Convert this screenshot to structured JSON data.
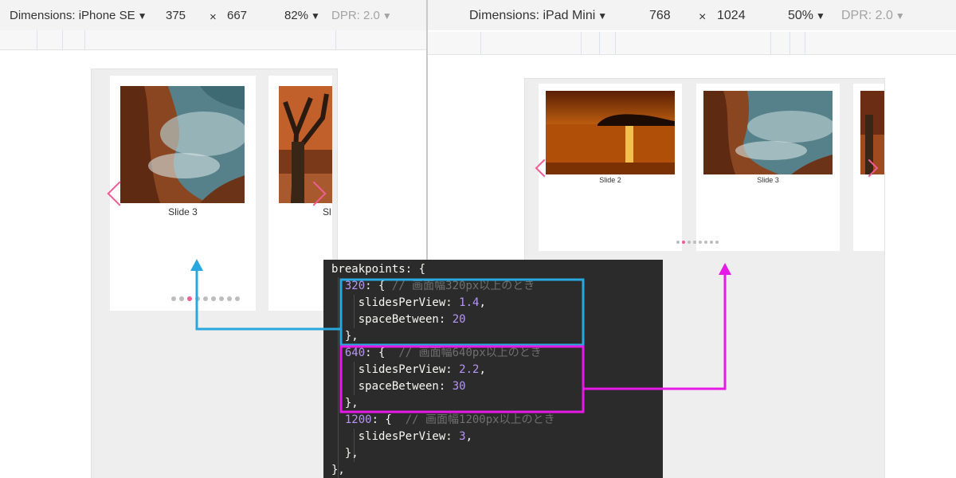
{
  "left": {
    "dimensions_label": "Dimensions: iPhone SE",
    "width": "375",
    "times": "×",
    "height": "667",
    "zoom": "82%",
    "dpr": "DPR: 2.0",
    "slides": [
      {
        "caption": "Slide 3",
        "image": "rocky-coast-photo"
      },
      {
        "caption": "Sl",
        "image": "autumn-tree-photo"
      }
    ],
    "pagination_count": 9,
    "active_dot": 2
  },
  "right": {
    "dimensions_label": "Dimensions: iPad Mini",
    "width": "768",
    "times": "×",
    "height": "1024",
    "zoom": "50%",
    "dpr": "DPR: 2.0",
    "slides": [
      {
        "caption": "Slide 2",
        "image": "sunset-lake-photo"
      },
      {
        "caption": "Slide 3",
        "image": "rocky-coast-photo"
      }
    ],
    "pagination_count": 8,
    "active_dot": 1
  },
  "code": {
    "line_1": "breakpoints: {",
    "bp320_key": "320",
    "bp320_open": ": { ",
    "bp320_comment": "// 画面幅320px以上のとき",
    "bp320_spv_key": "slidesPerView: ",
    "bp320_spv": "1.4",
    "bp320_sb_key": "spaceBetween: ",
    "bp320_sb": "20",
    "close_a": "},",
    "bp640_key": "640",
    "bp640_open": ": {  ",
    "bp640_comment": "// 画面幅640px以上のとき",
    "bp640_spv_key": "slidesPerView: ",
    "bp640_spv": "2.2",
    "bp640_sb_key": "spaceBetween: ",
    "bp640_sb": "30",
    "close_b": "},",
    "bp1200_key": "1200",
    "bp1200_open": ": {  ",
    "bp1200_comment": "// 画面幅1200px以上のとき",
    "bp1200_spv_key": "slidesPerView: ",
    "bp1200_spv": "3",
    "comma": ",",
    "close_c": "},",
    "close_outer": "},"
  },
  "colors": {
    "accent_pink": "#ef5c96",
    "annotation_cyan": "#29a8df",
    "annotation_magenta": "#e619e6",
    "code_bg": "#2b2b2b",
    "number_purple": "#b794f6"
  }
}
